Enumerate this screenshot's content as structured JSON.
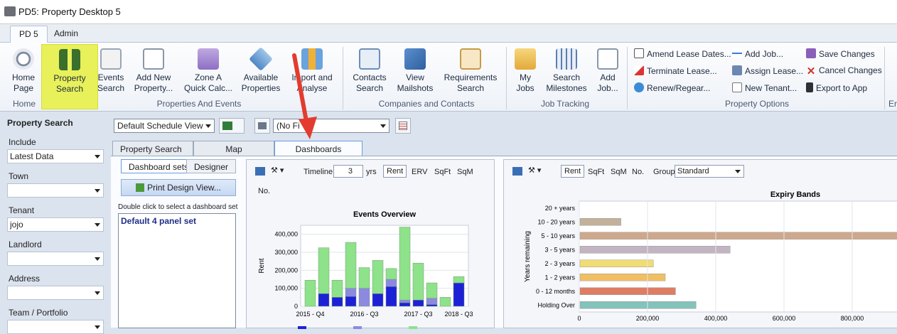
{
  "app": {
    "title": "PD5: Property Desktop 5"
  },
  "ribbon_tabs": [
    {
      "label": "PD 5"
    },
    {
      "label": "Admin"
    }
  ],
  "ribbon": {
    "buttons": [
      {
        "label1": "Home",
        "label2": "Page",
        "icon": "compass-icon"
      },
      {
        "label1": "Property",
        "label2": "Search",
        "icon": "binoculars-icon"
      },
      {
        "label1": "Events",
        "label2": "Search",
        "icon": "calendar-clock-icon"
      },
      {
        "label1": "Add New",
        "label2": "Property...",
        "icon": "add-document-icon"
      },
      {
        "label1": "Zone A",
        "label2": "Quick Calc...",
        "icon": "calculator-icon"
      },
      {
        "label1": "Available",
        "label2": "Properties",
        "icon": "tag-icon"
      },
      {
        "label1": "Import and",
        "label2": "Analyse",
        "icon": "import-chart-icon"
      },
      {
        "label1": "Contacts",
        "label2": "Search",
        "icon": "contact-card-icon"
      },
      {
        "label1": "View",
        "label2": "Mailshots",
        "icon": "mail-icon"
      },
      {
        "label1": "Requirements",
        "label2": "Search",
        "icon": "clipboard-icon"
      },
      {
        "label1": "My",
        "label2": "Jobs",
        "icon": "folder-icon"
      },
      {
        "label1": "Search",
        "label2": "Milestones",
        "icon": "grid-calendar-icon"
      },
      {
        "label1": "Add",
        "label2": "Job...",
        "icon": "add-job-icon"
      }
    ],
    "groups": [
      "Home",
      "Properties And Events",
      "Companies and Contacts",
      "Job Tracking",
      "Property Options",
      "Er"
    ],
    "property_options": [
      {
        "label": "Amend Lease Dates...",
        "icon": "calendar-31-icon"
      },
      {
        "label": "Terminate Lease...",
        "icon": "terminate-icon"
      },
      {
        "label": "Renew/Regear...",
        "icon": "renew-icon"
      },
      {
        "label": "Add Job...",
        "icon": "plus-icon"
      },
      {
        "label": "Assign Lease...",
        "icon": "assign-icon"
      },
      {
        "label": "New Tenant...",
        "icon": "new-tenant-icon"
      },
      {
        "label": "Save Changes",
        "icon": "save-icon"
      },
      {
        "label": "Cancel Changes",
        "icon": "cancel-x-icon"
      },
      {
        "label": "Export to App",
        "icon": "phone-icon"
      }
    ]
  },
  "left": {
    "header": "Property Search",
    "fields": [
      {
        "label": "Include",
        "value": "Latest Data"
      },
      {
        "label": "Town",
        "value": ""
      },
      {
        "label": "Tenant",
        "value": "jojo"
      },
      {
        "label": "Landlord",
        "value": ""
      },
      {
        "label": "Address",
        "value": ""
      },
      {
        "label": "Team / Portfolio",
        "value": ""
      }
    ]
  },
  "toolbar": {
    "schedule_view": "Default Schedule View",
    "filter": "(No Fi"
  },
  "panel_tabs": [
    {
      "label": "Property Search"
    },
    {
      "label": "Map"
    },
    {
      "label": "Dashboards"
    }
  ],
  "dashboard": {
    "subtabs": [
      {
        "label": "Dashboard sets"
      },
      {
        "label": "Designer"
      }
    ],
    "print_button": "Print Design View...",
    "hint": "Double click to select a dashboard set",
    "sets": [
      "Default 4 panel set"
    ]
  },
  "events_panel": {
    "timeline_label": "Timeline",
    "timeline_value": "3",
    "yrs": "yrs",
    "modes": [
      "Rent",
      "ERV",
      "SqFt",
      "SqM"
    ],
    "no_label": "No."
  },
  "expiry_panel": {
    "modes": [
      "Rent",
      "SqFt",
      "SqM"
    ],
    "no_label": "No.",
    "group_label": "Group",
    "group_value": "Standard"
  },
  "colors": {
    "accent": "#e8f05a",
    "arrow": "#e33b2f",
    "green": "#8ee28a",
    "blue": "#1d21d6",
    "lavender": "#8c89e0"
  },
  "chart_data": [
    {
      "type": "bar",
      "title": "Events Overview",
      "ylabel": "Rent",
      "ylim": [
        0,
        450000
      ],
      "yticks": [
        "400,000",
        "300,000",
        "200,000",
        "100,000",
        "0"
      ],
      "xtick_labels": [
        "2015 - Q4",
        "2016 - Q3",
        "2017 - Q3",
        "2018 - Q3"
      ],
      "series": [
        {
          "values": [
            0,
            70000,
            50000,
            55000,
            0,
            70000,
            110000,
            20000,
            35000,
            10000,
            0,
            130000
          ]
        },
        {
          "values": [
            0,
            0,
            0,
            45000,
            100000,
            0,
            40000,
            15000,
            0,
            35000,
            0,
            0
          ]
        },
        {
          "values": [
            145000,
            255000,
            95000,
            255000,
            115000,
            185000,
            60000,
            405000,
            205000,
            85000,
            50000,
            35000
          ]
        }
      ]
    },
    {
      "type": "bar",
      "title": "Expiry Bands",
      "ylabel": "Years remaining",
      "categories": [
        "20 + years",
        "10 - 20 years",
        "5 - 10 years",
        "3 - 5 years",
        "2 - 3 years",
        "1 - 2 years",
        "0 - 12 months",
        "Holding Over"
      ],
      "values": [
        0,
        120000,
        1000000,
        440000,
        215000,
        250000,
        280000,
        340000
      ],
      "xticks": [
        "0",
        "200,000",
        "400,000",
        "600,000",
        "800,000"
      ],
      "xlim": [
        0,
        1000000
      ]
    }
  ]
}
